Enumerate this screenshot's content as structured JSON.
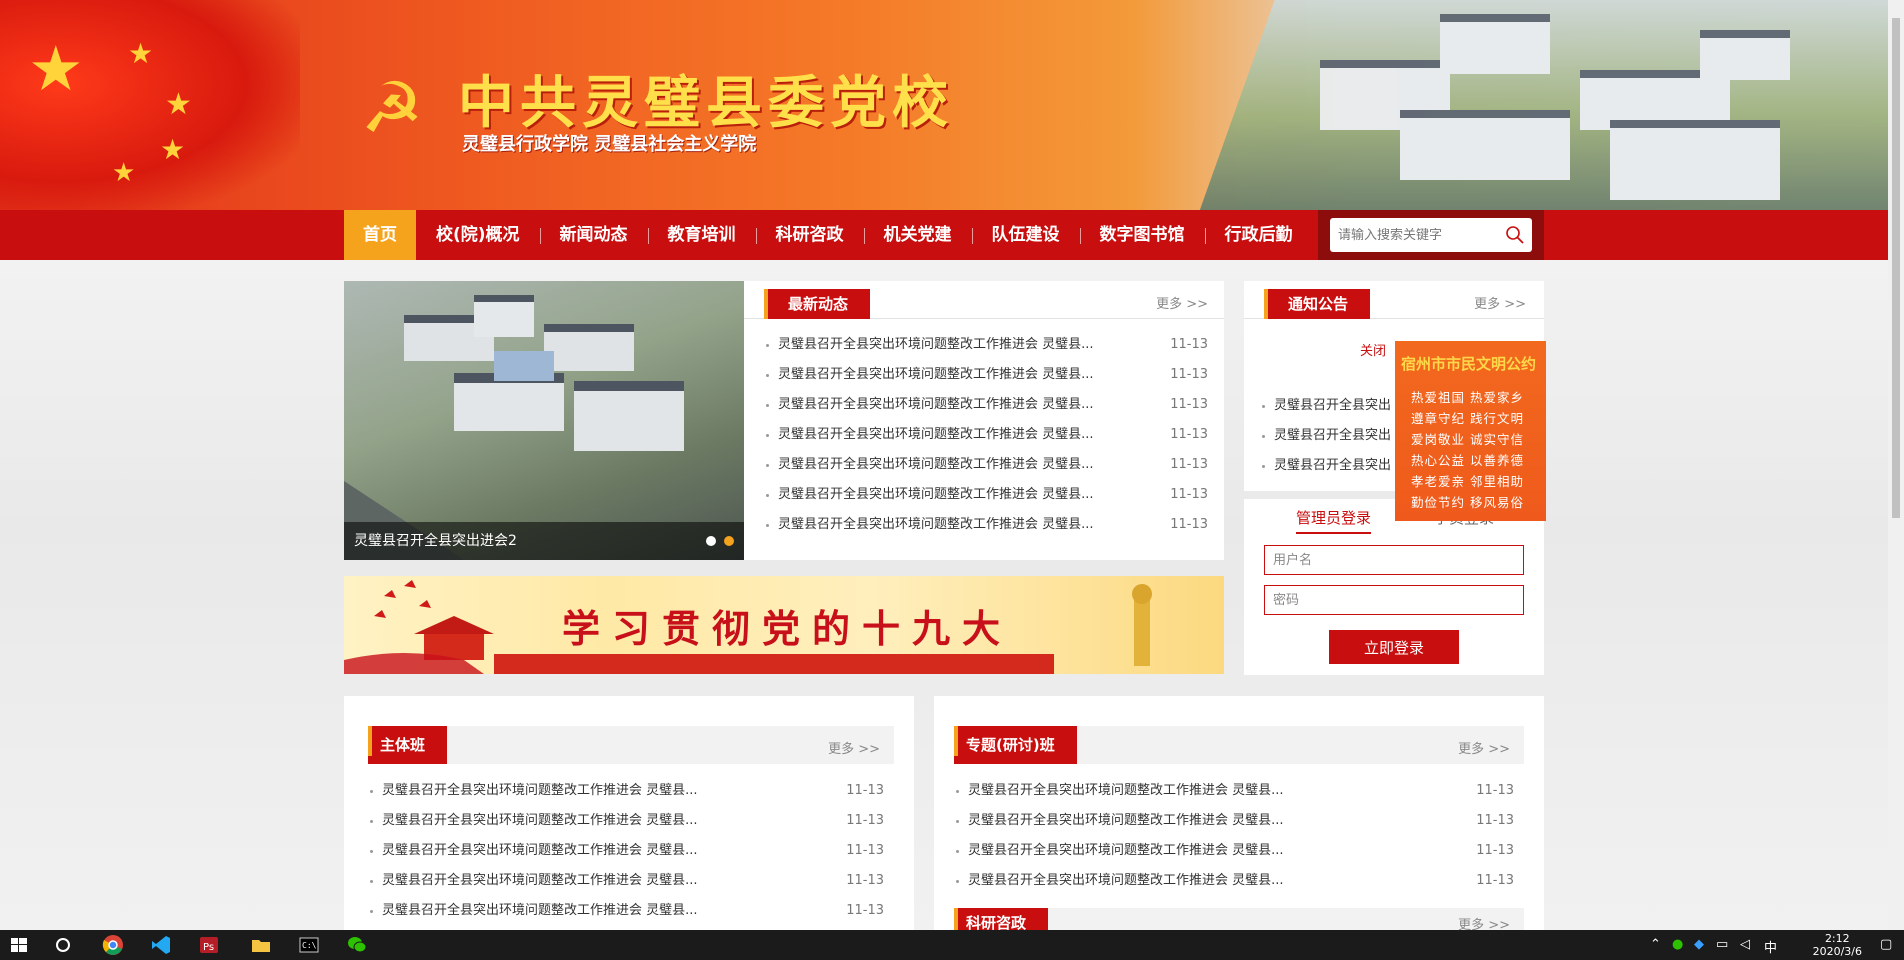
{
  "header": {
    "title": "中共灵璧县委党校",
    "subtitle": "灵璧县行政学院  灵璧县社会主义学院"
  },
  "nav": {
    "items": [
      {
        "label": "首页"
      },
      {
        "label": "校(院)概况"
      },
      {
        "label": "新闻动态"
      },
      {
        "label": "教育培训"
      },
      {
        "label": "科研咨政"
      },
      {
        "label": "机关党建"
      },
      {
        "label": "队伍建设"
      },
      {
        "label": "数字图书馆"
      },
      {
        "label": "行政后勤"
      }
    ],
    "search_placeholder": "请输入搜索关键字"
  },
  "slider": {
    "caption": "灵璧县召开全县突出进会2"
  },
  "latest_news": {
    "title": "最新动态",
    "more": "更多 >>",
    "items": [
      {
        "text": "灵璧县召开全县突出环境问题整改工作推进会 灵璧县...",
        "date": "11-13"
      },
      {
        "text": "灵璧县召开全县突出环境问题整改工作推进会 灵璧县...",
        "date": "11-13"
      },
      {
        "text": "灵璧县召开全县突出环境问题整改工作推进会 灵璧县...",
        "date": "11-13"
      },
      {
        "text": "灵璧县召开全县突出环境问题整改工作推进会 灵璧县...",
        "date": "11-13"
      },
      {
        "text": "灵璧县召开全县突出环境问题整改工作推进会 灵璧县...",
        "date": "11-13"
      },
      {
        "text": "灵璧县召开全县突出环境问题整改工作推进会 灵璧县...",
        "date": "11-13"
      },
      {
        "text": "灵璧县召开全县突出环境问题整改工作推进会 灵璧县...",
        "date": "11-13"
      }
    ]
  },
  "notice": {
    "title": "通知公告",
    "more": "更多 >>",
    "items": [
      {
        "text": "灵璧县召开全县突出"
      },
      {
        "text": "灵璧县召开全县突出"
      },
      {
        "text": "灵璧县召开全县突出"
      }
    ]
  },
  "close_link": "关闭",
  "civility": {
    "title": "宿州市市民文明公约",
    "rows": [
      "热爱祖国  热爱家乡",
      "遵章守纪  践行文明",
      "爱岗敬业  诚实守信",
      "热心公益  以善养德",
      "孝老爱亲  邻里相助",
      "勤俭节约  移风易俗"
    ]
  },
  "login": {
    "tab_admin": "管理员登录",
    "tab_other": "学员登录",
    "username_placeholder": "用户名",
    "password_placeholder": "密码",
    "submit": "立即登录"
  },
  "study_banner": {
    "text": "学习贯彻党的十九大"
  },
  "main_class": {
    "title": "主体班",
    "more": "更多 >>",
    "items": [
      {
        "text": "灵璧县召开全县突出环境问题整改工作推进会 灵璧县...",
        "date": "11-13"
      },
      {
        "text": "灵璧县召开全县突出环境问题整改工作推进会 灵璧县...",
        "date": "11-13"
      },
      {
        "text": "灵璧县召开全县突出环境问题整改工作推进会 灵璧县...",
        "date": "11-13"
      },
      {
        "text": "灵璧县召开全县突出环境问题整改工作推进会 灵璧县...",
        "date": "11-13"
      },
      {
        "text": "灵璧县召开全县突出环境问题整改工作推进会 灵璧县...",
        "date": "11-13"
      }
    ]
  },
  "topic_class": {
    "title": "专题(研讨)班",
    "more": "更多 >>",
    "items": [
      {
        "text": "灵璧县召开全县突出环境问题整改工作推进会 灵璧县...",
        "date": "11-13"
      },
      {
        "text": "灵璧县召开全县突出环境问题整改工作推进会 灵璧县...",
        "date": "11-13"
      },
      {
        "text": "灵璧县召开全县突出环境问题整改工作推进会 灵璧县...",
        "date": "11-13"
      },
      {
        "text": "灵璧县召开全县突出环境问题整改工作推进会 灵璧县...",
        "date": "11-13"
      }
    ]
  },
  "research": {
    "title": "科研咨政",
    "more": "更多 >>"
  },
  "taskbar": {
    "time": "2:12",
    "date": "2020/3/6",
    "ime": "中"
  }
}
